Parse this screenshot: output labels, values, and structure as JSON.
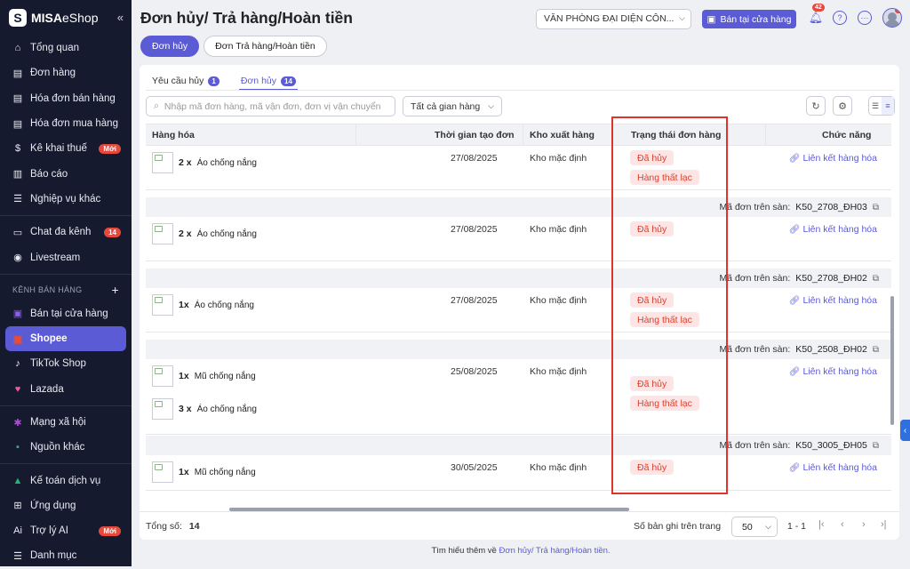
{
  "brand": {
    "bold": "MISA",
    "light": "eShop"
  },
  "sidebar": {
    "collapse": "«",
    "items": [
      {
        "label": "Tổng quan",
        "icon": "home-icon",
        "glyph": "⌂"
      },
      {
        "label": "Đơn hàng",
        "icon": "order-icon",
        "glyph": "▤"
      },
      {
        "label": "Hóa đơn bán hàng",
        "icon": "invoice-icon",
        "glyph": "▤"
      },
      {
        "label": "Hóa đơn mua hàng",
        "icon": "purchase-invoice-icon",
        "glyph": "▤"
      },
      {
        "label": "Kê khai thuế",
        "icon": "tax-icon",
        "glyph": "$",
        "badge": "Mới"
      },
      {
        "label": "Báo cáo",
        "icon": "chart-icon",
        "glyph": "▥"
      },
      {
        "label": "Nghiệp vụ khác",
        "icon": "tasks-icon",
        "glyph": "☰"
      }
    ],
    "items2": [
      {
        "label": "Chat đa kênh",
        "icon": "chat-icon",
        "glyph": "▭",
        "badge": "14"
      },
      {
        "label": "Livestream",
        "icon": "live-icon",
        "glyph": "◉"
      }
    ],
    "section": "KÊNH BÁN HÀNG",
    "channels": [
      {
        "label": "Bán tại cửa hàng",
        "icon": "store-icon",
        "glyph": "▣",
        "color": "#8b5cf6"
      },
      {
        "label": "Shopee",
        "icon": "shopee-icon",
        "glyph": "▣",
        "color": "#ee4d2d",
        "active": true
      },
      {
        "label": "TikTok Shop",
        "icon": "tiktok-icon",
        "glyph": "♪",
        "color": "#ffffff"
      },
      {
        "label": "Lazada",
        "icon": "lazada-icon",
        "glyph": "♥",
        "color": "#f0589b"
      }
    ],
    "items3": [
      {
        "label": "Mạng xã hội",
        "icon": "social-icon",
        "glyph": "✱",
        "color": "#b14ad8"
      },
      {
        "label": "Nguồn khác",
        "icon": "cart-icon",
        "glyph": "▪",
        "color": "#22b573"
      }
    ],
    "items4": [
      {
        "label": "Kế toán dịch vụ",
        "icon": "accounting-icon",
        "glyph": "▲",
        "color": "#22b573"
      },
      {
        "label": "Ứng dụng",
        "icon": "apps-icon",
        "glyph": "⊞"
      },
      {
        "label": "Trợ lý AI",
        "icon": "ai-icon",
        "glyph": "Ai",
        "badge": "Mới"
      },
      {
        "label": "Danh mục",
        "icon": "list-icon",
        "glyph": "☰"
      }
    ]
  },
  "header": {
    "title": "Đơn hủy/ Trả hàng/Hoàn tiền",
    "branch": "VĂN PHÒNG ĐẠI DIỆN CÔN...",
    "sell_button": "Bán tại cửa hàng",
    "bell_badge": "42",
    "avatar_badge": "1"
  },
  "page_tabs": [
    "Đơn hủy",
    "Đơn Trả hàng/Hoàn tiền"
  ],
  "sub_tabs": [
    {
      "label": "Yêu cầu hủy",
      "count": "1"
    },
    {
      "label": "Đơn hủy",
      "count": "14"
    }
  ],
  "filters": {
    "search_placeholder": "Nhập mã đơn hàng, mã vận đơn, đơn vị vận chuyển",
    "shop": "Tất cả gian hàng"
  },
  "columns": [
    "Hàng hóa",
    "Thời gian tạo đơn",
    "Kho xuất hàng",
    "Trạng thái đơn hàng",
    "Chức năng"
  ],
  "order_label": "Mã đơn trên sàn:",
  "link_label": "Liên kết hàng hóa",
  "orders": [
    {
      "code": "",
      "items": [
        {
          "qty": "2 x",
          "name": "Áo chống nắng"
        }
      ],
      "date": "27/08/2025",
      "warehouse": "Kho mặc định",
      "tags": [
        "Đã hủy",
        "Hàng thất lạc"
      ]
    },
    {
      "code": "K50_2708_ĐH03",
      "items": [
        {
          "qty": "2 x",
          "name": "Áo chống nắng"
        }
      ],
      "date": "27/08/2025",
      "warehouse": "Kho mặc định",
      "tags": [
        "Đã hủy"
      ]
    },
    {
      "code": "K50_2708_ĐH02",
      "items": [
        {
          "qty": "1x",
          "name": "Áo chống nắng"
        }
      ],
      "date": "27/08/2025",
      "warehouse": "Kho mặc định",
      "tags": [
        "Đã hủy",
        "Hàng thất lạc"
      ]
    },
    {
      "code": "K50_2508_ĐH02",
      "items": [
        {
          "qty": "1x",
          "name": "Mũ chống nắng"
        },
        {
          "qty": "3 x",
          "name": "Áo chống nắng"
        }
      ],
      "date": "25/08/2025",
      "warehouse": "Kho mặc định",
      "tags": [
        "Đã hủy",
        "Hàng thất lạc"
      ]
    },
    {
      "code": "K50_3005_ĐH05",
      "items": [
        {
          "qty": "1x",
          "name": "Mũ chống nắng"
        }
      ],
      "date": "30/05/2025",
      "warehouse": "Kho mặc định",
      "tags": [
        "Đã hủy"
      ]
    }
  ],
  "footer": {
    "total_label": "Tổng số:",
    "total": "14",
    "page_size_label": "Số bản ghi trên trang",
    "page_size": "50",
    "range": "1 - 1"
  },
  "learn": {
    "prefix": "Tìm hiểu thêm về",
    "link": "Đơn hủy/ Trả hàng/Hoàn tiền."
  }
}
